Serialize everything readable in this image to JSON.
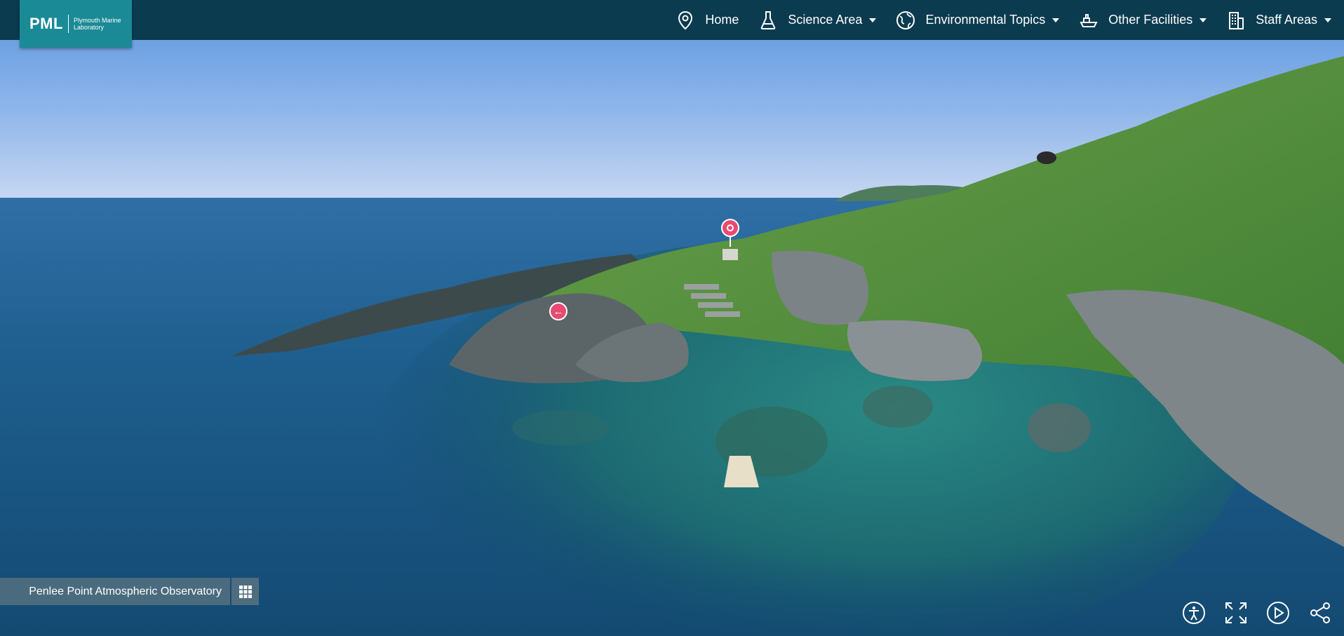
{
  "brand": {
    "mark": "PML",
    "name": "Plymouth Marine Laboratory"
  },
  "nav": {
    "items": [
      {
        "label": "Home",
        "icon": "map-pin-icon",
        "dropdown": false
      },
      {
        "label": "Science Area",
        "icon": "flask-icon",
        "dropdown": true
      },
      {
        "label": "Environmental Topics",
        "icon": "globe-icon",
        "dropdown": true
      },
      {
        "label": "Other Facilities",
        "icon": "ship-icon",
        "dropdown": true
      },
      {
        "label": "Staff Areas",
        "icon": "building-icon",
        "dropdown": true
      }
    ]
  },
  "location": {
    "title": "Penlee Point Atmospheric Observatory",
    "grid_icon": "grid-icon"
  },
  "controls": [
    {
      "name": "accessibility-icon"
    },
    {
      "name": "fullscreen-icon"
    },
    {
      "name": "play-icon"
    },
    {
      "name": "share-icon"
    }
  ],
  "hotspots": [
    {
      "name": "info-pin-icon"
    },
    {
      "name": "back-arrow-icon",
      "glyph": "←"
    }
  ],
  "colors": {
    "navbar": "#0b3b4f",
    "logo": "#1a8a96",
    "hotspot": "#e84a72"
  }
}
